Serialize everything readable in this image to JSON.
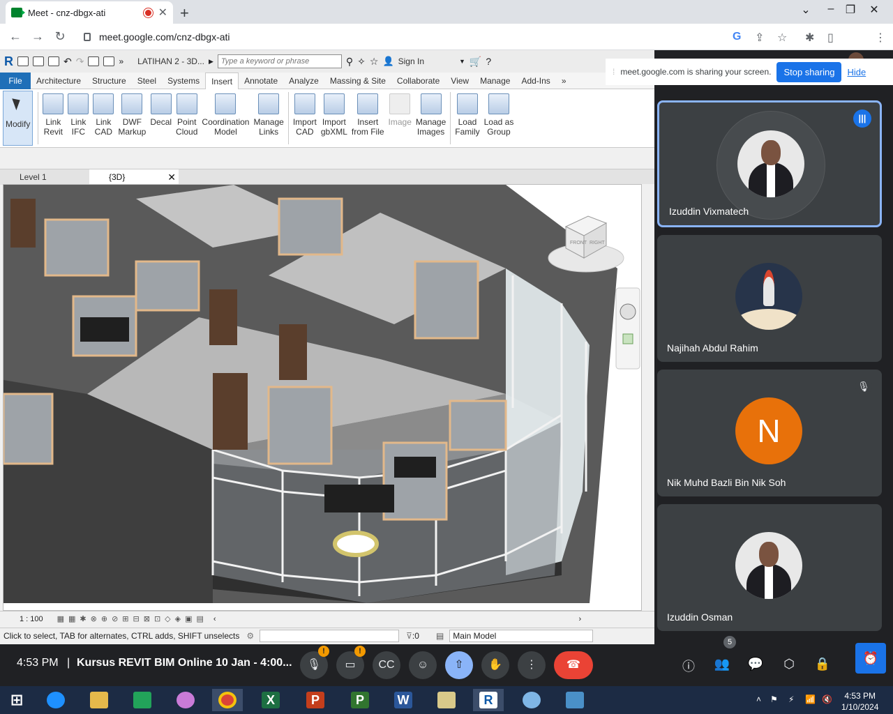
{
  "browser": {
    "tab_title": "Meet - cnz-dbgx-ati",
    "url": "meet.google.com/cnz-dbgx-ati"
  },
  "revit": {
    "project_title": "LATIHAN 2 - 3D...",
    "search_placeholder": "Type a keyword or phrase",
    "sign_in": "Sign In",
    "ribbon_tabs": [
      "File",
      "Architecture",
      "Structure",
      "Steel",
      "Systems",
      "Insert",
      "Annotate",
      "Analyze",
      "Massing & Site",
      "Collaborate",
      "View",
      "Manage",
      "Add-Ins"
    ],
    "active_tab": "Insert",
    "ribbon_buttons": [
      {
        "label": "Modify",
        "icon": "cursor-icon"
      },
      {
        "label": "Link\nRevit",
        "icon": "link-revit-icon"
      },
      {
        "label": "Link\nIFC",
        "icon": "link-ifc-icon"
      },
      {
        "label": "Link\nCAD",
        "icon": "link-cad-icon"
      },
      {
        "label": "DWF\nMarkup",
        "icon": "dwf-markup-icon"
      },
      {
        "label": "Decal",
        "icon": "decal-icon"
      },
      {
        "label": "Point\nCloud",
        "icon": "point-cloud-icon"
      },
      {
        "label": "Coordination\nModel",
        "icon": "coordination-model-icon"
      },
      {
        "label": "Manage\nLinks",
        "icon": "manage-links-icon"
      },
      {
        "label": "Import\nCAD",
        "icon": "import-cad-icon"
      },
      {
        "label": "Import\ngbXML",
        "icon": "import-gbxml-icon"
      },
      {
        "label": "Insert\nfrom File",
        "icon": "insert-from-file-icon"
      },
      {
        "label": "Image",
        "icon": "image-icon"
      },
      {
        "label": "Manage\nImages",
        "icon": "manage-images-icon"
      },
      {
        "label": "Load\nFamily",
        "icon": "load-family-icon"
      },
      {
        "label": "Load as\nGroup",
        "icon": "load-as-group-icon"
      }
    ],
    "view_tabs": [
      "Level 1",
      "{3D}"
    ],
    "scale": "1 : 100",
    "status_text": "Click to select, TAB for alternates, CTRL adds, SHIFT unselects",
    "selection_count": ":0",
    "workset": "Main Model"
  },
  "meet": {
    "sharing_text": "meet.google.com is sharing your screen.",
    "stop_sharing": "Stop sharing",
    "hide": "Hide",
    "participants": [
      {
        "name": "Izuddin Vixmatech",
        "avatar": "photo",
        "speaking": true
      },
      {
        "name": "Najihah Abdul Rahim",
        "avatar": "rocket",
        "speaking": false
      },
      {
        "name": "Nik Muhd Bazli Bin Nik Soh",
        "avatar": "letter",
        "letter": "N",
        "muted": true
      },
      {
        "name": "Izuddin Osman",
        "avatar": "photo",
        "speaking": false
      }
    ],
    "time": "4:53 PM",
    "meeting_title": "Kursus REVIT BIM Online 10 Jan - 4:00...",
    "participant_count": "5"
  },
  "taskbar": {
    "time": "4:53 PM",
    "date": "1/10/2024"
  },
  "colors": {
    "revit_file_tab": "#1f6fb8",
    "meet_blue": "#1a73e8",
    "end_call": "#ea4335",
    "letter_avatar": "#e8710a"
  }
}
